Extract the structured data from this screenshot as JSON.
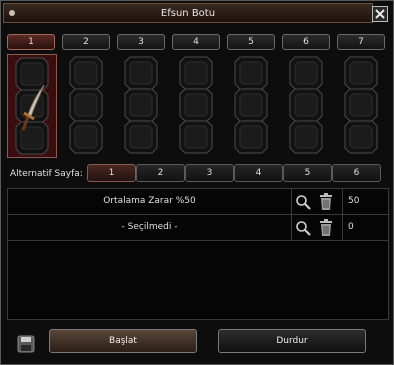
{
  "window": {
    "title": "Efsun Botu"
  },
  "columns": [
    {
      "label": "1",
      "active": true
    },
    {
      "label": "2",
      "active": false
    },
    {
      "label": "3",
      "active": false
    },
    {
      "label": "4",
      "active": false
    },
    {
      "label": "5",
      "active": false
    },
    {
      "label": "6",
      "active": false
    },
    {
      "label": "7",
      "active": false
    }
  ],
  "alternate": {
    "label": "Alternatif Sayfa:",
    "pages": [
      "1",
      "2",
      "3",
      "4",
      "5",
      "6"
    ],
    "active_index": 0
  },
  "rows": [
    {
      "name": "Ortalama Zarar %50",
      "value": "50"
    },
    {
      "name": "- Seçilmedi -",
      "value": "0"
    }
  ],
  "footer": {
    "start_label": "Başlat",
    "stop_label": "Durdur"
  },
  "icons": {
    "close": "close-icon",
    "search": "search-icon",
    "trash": "trash-icon",
    "save": "floppy-disk-icon",
    "item": "sword-icon"
  },
  "colors": {
    "active_tab": "#5a2a22",
    "active_column": "#3a0e0e",
    "accent_border": "#a06a5a"
  }
}
